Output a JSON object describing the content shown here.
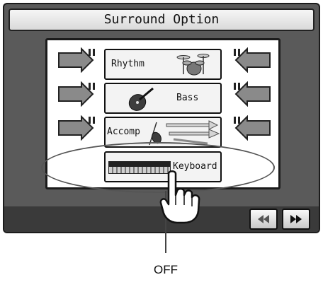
{
  "screen": {
    "title": "Surround Option",
    "parts": [
      {
        "label": "Rhythm",
        "icon": "drum-kit-icon"
      },
      {
        "label": "Bass",
        "icon": "double-bass-icon"
      },
      {
        "label": "Accomp",
        "icon": "orchestra-instruments-icon"
      },
      {
        "label": "Keyboard",
        "icon": "piano-keys-icon"
      }
    ],
    "nav": {
      "prev_icon": "double-left-arrow-icon",
      "next_icon": "double-right-arrow-icon"
    }
  },
  "callout": {
    "label": "OFF"
  },
  "colors": {
    "screen_bg": "#5a5a5a",
    "panel_bg": "#ffffff",
    "bottom_bar": "#3a3a3a"
  }
}
